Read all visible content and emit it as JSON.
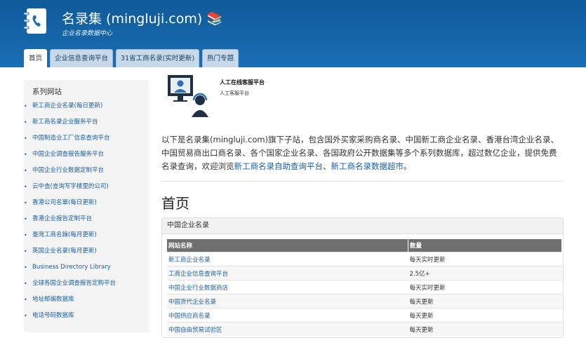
{
  "header": {
    "title": "名录集 (mingluji.com) 📚",
    "subtitle": "企业名录数据中心"
  },
  "tabs": [
    {
      "label": "首页"
    },
    {
      "label": "企业信息查询平台"
    },
    {
      "label": "31省工商名录(实时更新)"
    },
    {
      "label": "热门专题"
    }
  ],
  "sidebar": {
    "title": "系列网站",
    "items": [
      {
        "label": "新工商企业名录(每日更新)"
      },
      {
        "label": "新工商名录企业服务平台"
      },
      {
        "label": "中国制造业工厂信息查询平台"
      },
      {
        "label": "中国企业调查报告服务平台"
      },
      {
        "label": "中国企业行业数据定制平台"
      },
      {
        "label": "云中查(查询写字楼里的公司)"
      },
      {
        "label": "香港公司名單(每日更新)"
      },
      {
        "label": "香港企业报告定制平台"
      },
      {
        "label": "臺灣工商名錄(每月更新)"
      },
      {
        "label": "英国企业名录(每月更新)"
      },
      {
        "label": "Business Directory Library"
      },
      {
        "label": "全球各国企业调查报告定购平台"
      },
      {
        "label": "地址邮编数据库"
      },
      {
        "label": "电话号码数据库"
      }
    ]
  },
  "support": {
    "title": "人工在线客服平台",
    "subtitle": "人工客服平台"
  },
  "intro": {
    "text": "以下是名录集(mingluji.com)旗下子站，包含国外买家采购商名录、中国新工商企业名录、香港台湾企业名录、中国贸易商出口商名录、各个国家企业名录、各国政府公开数据集等多个系列数据库，超过数亿企业，提供免费名录查询，欢迎浏览",
    "link1": "新工商名录自助查询平台",
    "sep": "、",
    "link2": "新工商名录数据超市",
    "end": "。"
  },
  "page_heading": "首页",
  "panel": {
    "title": "中国企业名录",
    "columns": [
      "网站名称",
      "数量"
    ],
    "rows": [
      {
        "name": "新工商企业名录",
        "qty": "每天实时更新"
      },
      {
        "name": "工商企业信息查询平台",
        "qty": "2.5亿+"
      },
      {
        "name": "中国企业行业数据商店",
        "qty": "每天实时更新"
      },
      {
        "name": "中国货代企业名录",
        "qty": "每天更新"
      },
      {
        "name": "中国供应商名录",
        "qty": "每天更新"
      },
      {
        "name": "中国自由贸易试验区",
        "qty": "每天更新"
      }
    ]
  },
  "colors": {
    "header_bg": "#1a6fb5",
    "link": "#1a5fa8",
    "table_head": "#6f6f6f"
  },
  "icons": [
    "address-book-icon",
    "support-agent-icon"
  ]
}
